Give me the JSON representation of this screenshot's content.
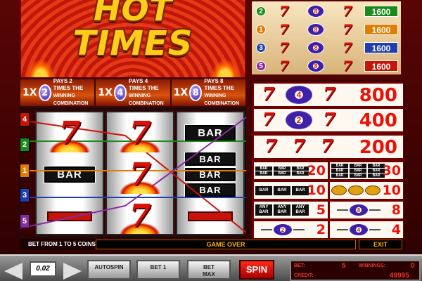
{
  "logo": {
    "line1": "HOT",
    "line2": "TIMES"
  },
  "multiplier_panels": [
    {
      "mult": "1X",
      "badge": "2",
      "text1": "PAYS 2",
      "text2": "TIMES THE",
      "text3": "WINNING COMBINATION"
    },
    {
      "mult": "1X",
      "badge": "4",
      "text1": "PAYS 4",
      "text2": "TIMES THE",
      "text3": "WINNING COMBINATION"
    },
    {
      "mult": "1X",
      "badge": "8",
      "text1": "PAYS 8",
      "text2": "TIMES THE",
      "text3": "WINNING COMBINATION"
    }
  ],
  "line_numbers_left": [
    "4",
    "2",
    "1",
    "3",
    "5"
  ],
  "reels": [
    [
      "7",
      "BAR",
      "blank"
    ],
    [
      "7",
      "7",
      "7"
    ],
    [
      "BAR",
      "BAR BAR BAR",
      "blank"
    ]
  ],
  "lines_paytable": [
    {
      "line": "2",
      "amount": "1600",
      "color": "#1a8a1a"
    },
    {
      "line": "1",
      "amount": "1600",
      "color": "#e27d00"
    },
    {
      "line": "3",
      "amount": "1600",
      "color": "#1f3fb0"
    },
    {
      "line": "5",
      "amount": "1600",
      "color": "#8a2aa0"
    }
  ],
  "paytable": {
    "big_rows": [
      {
        "multiplier": "4",
        "amount": "800"
      },
      {
        "multiplier": "2",
        "amount": "400"
      },
      {
        "amount": "200"
      }
    ],
    "small_cells": [
      {
        "label": "BAR BAR BAR double",
        "amount": "20"
      },
      {
        "label": "BAR BAR BAR triple",
        "amount": "30"
      },
      {
        "label": "BAR BAR BAR single",
        "amount": "10"
      },
      {
        "label": "cherry cherry cherry",
        "amount": "10"
      },
      {
        "label": "ANY BAR",
        "amount": "5"
      },
      {
        "label": "8 multiplier",
        "amount": "8"
      },
      {
        "label": "2 multiplier",
        "amount": "2"
      },
      {
        "label": "4 multiplier",
        "amount": "4"
      }
    ],
    "bar_text": "BAR",
    "any_bar_text": [
      "ANY",
      "BAR"
    ]
  },
  "status": {
    "bet_range": "BET FROM 1 TO 5 COINS",
    "message": "GAME OVER",
    "exit": "EXIT"
  },
  "controls": {
    "coin_value": "0.02",
    "autospin": "AUTOSPIN",
    "bet_one": "BET 1",
    "bet_max_1": "BET",
    "bet_max_2": "MAX",
    "spin": "SPIN"
  },
  "display": {
    "bet_label": "BET:",
    "bet_value": "5",
    "winnings_label": "WINNINGS:",
    "winnings_value": "0",
    "credit_label": "CREDIT:",
    "credit_value": "49995"
  },
  "colors": {
    "line1": "#e27d00",
    "line2": "#1a8a1a",
    "line3": "#1f3fb0",
    "line4": "#c81408",
    "line5": "#8a2aa0",
    "accent_yellow": "#ffcc1a",
    "payout_red": "#e8130a"
  }
}
